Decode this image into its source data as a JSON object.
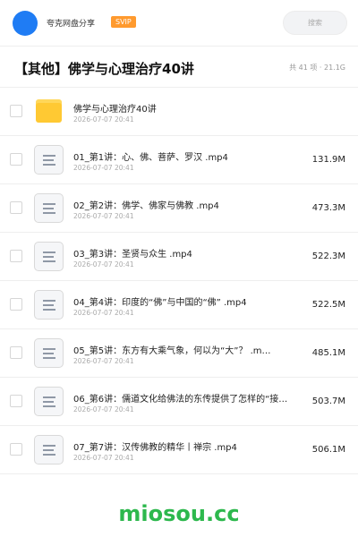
{
  "topbar": {
    "username": "夸克网盘分享",
    "badge": "SVIP",
    "search_placeholder": "搜索",
    "avatar_color": "#1f7cf4",
    "badge_color": "#ff9a2e"
  },
  "header": {
    "title": "【其他】佛学与心理治疗40讲",
    "summary": "共 41 项 · 21.1G"
  },
  "files": [
    {
      "type": "folder",
      "icon": "folder-icon",
      "name": "佛学与心理治疗40讲",
      "date": "2026-07-07 20:41",
      "size": ""
    },
    {
      "type": "file",
      "icon": "document-icon",
      "name": "01_第1讲：心、佛、菩萨、罗汉 .mp4",
      "date": "2026-07-07 20:41",
      "size": "131.9M"
    },
    {
      "type": "file",
      "icon": "document-icon",
      "name": "02_第2讲：佛学、佛家与佛教 .mp4",
      "date": "2026-07-07 20:41",
      "size": "473.3M"
    },
    {
      "type": "file",
      "icon": "document-icon",
      "name": "03_第3讲：圣贤与众生 .mp4",
      "date": "2026-07-07 20:41",
      "size": "522.3M"
    },
    {
      "type": "file",
      "icon": "document-icon",
      "name": "04_第4讲：印度的“佛”与中国的“佛” .mp4",
      "date": "2026-07-07 20:41",
      "size": "522.5M"
    },
    {
      "type": "file",
      "icon": "document-icon",
      "name": "05_第5讲：东方有大乘气象，何以为“大”？ .m…",
      "date": "2026-07-07 20:41",
      "size": "485.1M"
    },
    {
      "type": "file",
      "icon": "document-icon",
      "name": "06_第6讲：儒道文化给佛法的东传提供了怎样的“接…",
      "date": "2026-07-07 20:41",
      "size": "503.7M"
    },
    {
      "type": "file",
      "icon": "document-icon",
      "name": "07_第7讲：汉传佛教的精华丨禅宗 .mp4",
      "date": "2026-07-07 20:41",
      "size": "506.1M"
    }
  ],
  "watermark": "miosou.cc",
  "watermark_color": "#2db84d"
}
